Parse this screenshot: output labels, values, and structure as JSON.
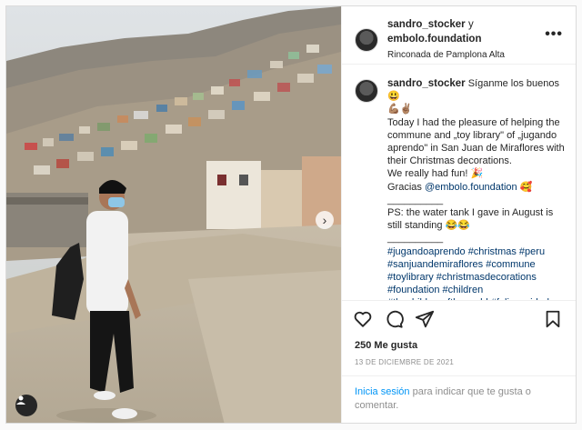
{
  "post": {
    "author": "sandro_stocker",
    "conjunction": "y",
    "coauthor": "embolo.foundation",
    "location": "Rinconada de Pamplona Alta",
    "more_icon": "more-options-icon"
  },
  "caption": {
    "author": "sandro_stocker",
    "line1": "Síganme los buenos 😃",
    "line2": "💪🏽✌🏽",
    "line3": "Today I had the pleasure of helping the commune and „toy library\" of „jugando aprendo\" in San Juan de Miraflores with their Christmas decorations.",
    "line4": "We really had fun! 🎉",
    "line5_prefix": "Gracias",
    "line5_mention": "@embolo.foundation",
    "line5_suffix": "🥰",
    "separator": "__________",
    "line6": "PS: the water tank I gave in August is still standing 😂😂",
    "hashtags": "#jugandoaprendo #christmas #peru #sanjuandemiraflores #commune #toylibrary #christmasdecorations #foundation #children #thechildrenoftheworld #feliznavidad #merrychristmas #embolofoundation"
  },
  "actions": {
    "like_icon": "heart-icon",
    "comment_icon": "comment-icon",
    "share_icon": "share-icon",
    "save_icon": "bookmark-icon"
  },
  "likes": "250 Me gusta",
  "date": "13 DE DICIEMBRE DE 2021",
  "login": {
    "link": "Inicia sesión",
    "text": "para indicar que te gusta o comentar."
  }
}
